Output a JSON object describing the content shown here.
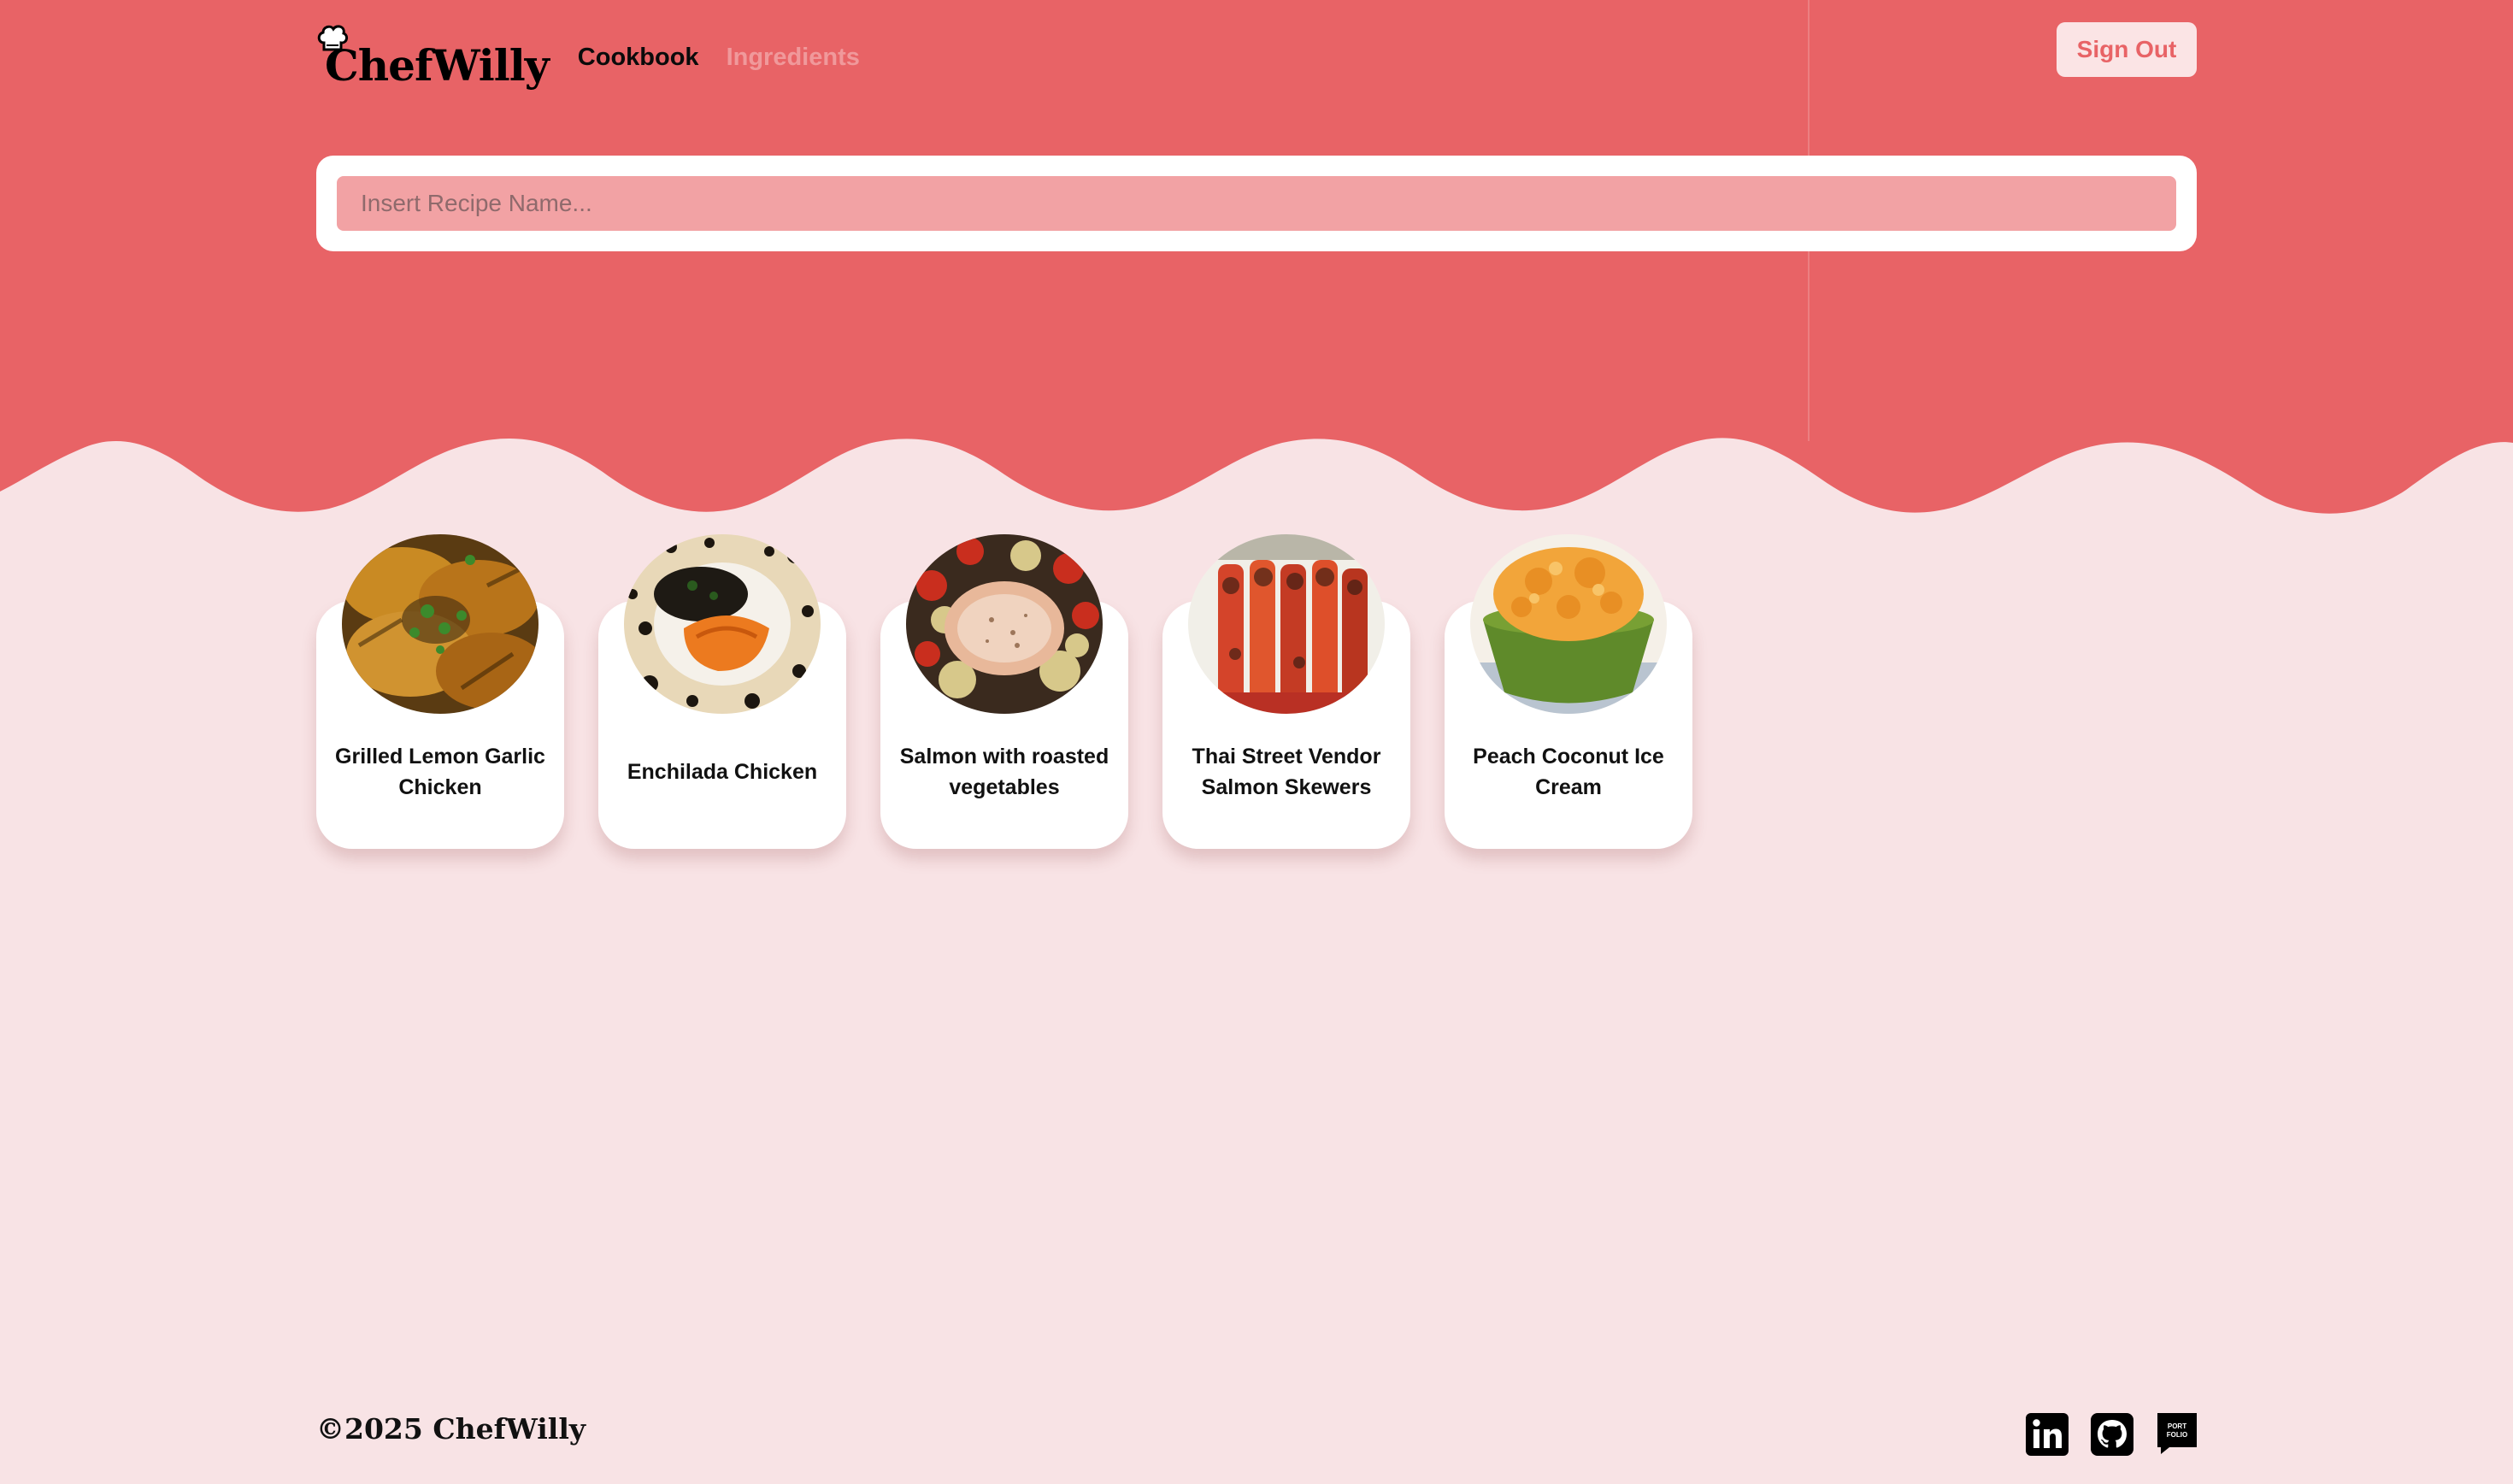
{
  "brand": {
    "name": "ChefWilly"
  },
  "nav": {
    "links": [
      {
        "label": "Cookbook",
        "active": true
      },
      {
        "label": "Ingredients",
        "active": false
      }
    ],
    "sign_out_label": "Sign Out"
  },
  "search": {
    "placeholder": "Insert Recipe Name...",
    "value": ""
  },
  "recipes": [
    {
      "title": "Grilled Lemon Garlic Chicken",
      "image_icon": "grilled-chicken-photo"
    },
    {
      "title": "Enchilada Chicken",
      "image_icon": "enchilada-chicken-photo"
    },
    {
      "title": "Salmon with roasted vegetables",
      "image_icon": "salmon-vegetables-photo"
    },
    {
      "title": "Thai Street Vendor Salmon Skewers",
      "image_icon": "salmon-skewers-photo"
    },
    {
      "title": "Peach Coconut Ice Cream",
      "image_icon": "ice-cream-photo"
    }
  ],
  "footer": {
    "copyright": "©2025 ChefWilly",
    "socials": [
      {
        "name": "linkedin-icon"
      },
      {
        "name": "github-icon"
      },
      {
        "name": "portfolio-icon",
        "text": "PORT FOLIO"
      }
    ]
  },
  "colors": {
    "accent": "#e86366",
    "background": "#f8e3e5",
    "search_field": "#f2a2a4",
    "sign_out_bg": "#fbe4e5"
  }
}
